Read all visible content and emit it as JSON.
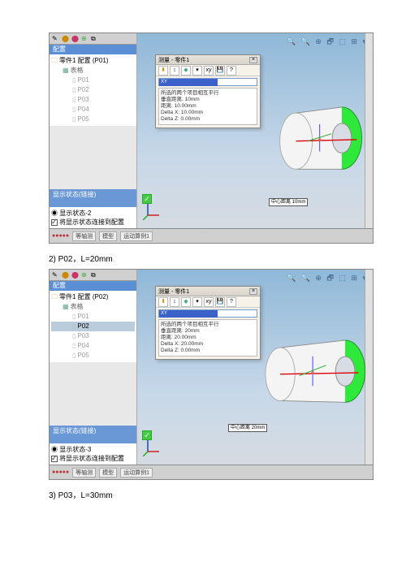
{
  "captions": {
    "p02": "2) P02，L=20mm",
    "p03": "3) P03，L=30mm"
  },
  "screenshot1": {
    "top_icons": "🔍 🔍 ⊕ 🗗 ⬚ ⊞ ▾",
    "panel_hdr": "配置",
    "tree_root": "零件1 配置 (P01)",
    "tree_table": "表格",
    "tree_items": [
      "P01",
      "P02",
      "P03",
      "P04",
      "P05"
    ],
    "display_state_title1": "显示状态(链接)",
    "display_state_title2": "",
    "display_state_item": "显示状态-2",
    "chk_label": "将显示状态连接到配置",
    "status_tabs": [
      "等轴测",
      "模型",
      "运动算例1"
    ],
    "dialog": {
      "title": "测量 - 零件1",
      "input_blue": "XY",
      "lines": [
        "所选的两个项目相互平行",
        "垂直距离: 10mm",
        "距离: 10.00mm",
        "Delta X: 10.00mm",
        "Delta Z: 0.00mm"
      ]
    },
    "label_tag": "中心距离 10mm"
  },
  "screenshot2": {
    "top_icons": "🔍 🔍 ⊕ 🗗 ⬚ ⊞ ▾",
    "panel_hdr": "配置",
    "tree_root": "零件1 配置 (P02)",
    "tree_table": "表格",
    "tree_items": [
      "P01",
      "P02",
      "P03",
      "P04",
      "P05"
    ],
    "display_state_title1": "显示状态(链接)",
    "display_state_title2": "",
    "display_state_item": "显示状态-3",
    "chk_label": "将显示状态连接到配置",
    "status_tabs": [
      "等轴测",
      "模型",
      "运动算例1"
    ],
    "dialog": {
      "title": "测量 - 零件1",
      "input_blue": "XY",
      "lines": [
        "所选的两个项目相互平行",
        "垂直距离: 20mm",
        "距离: 20.00mm",
        "Delta X: 20.00mm",
        "Delta Z: 0.00mm"
      ]
    },
    "label_tag": "中心距离 20mm"
  }
}
